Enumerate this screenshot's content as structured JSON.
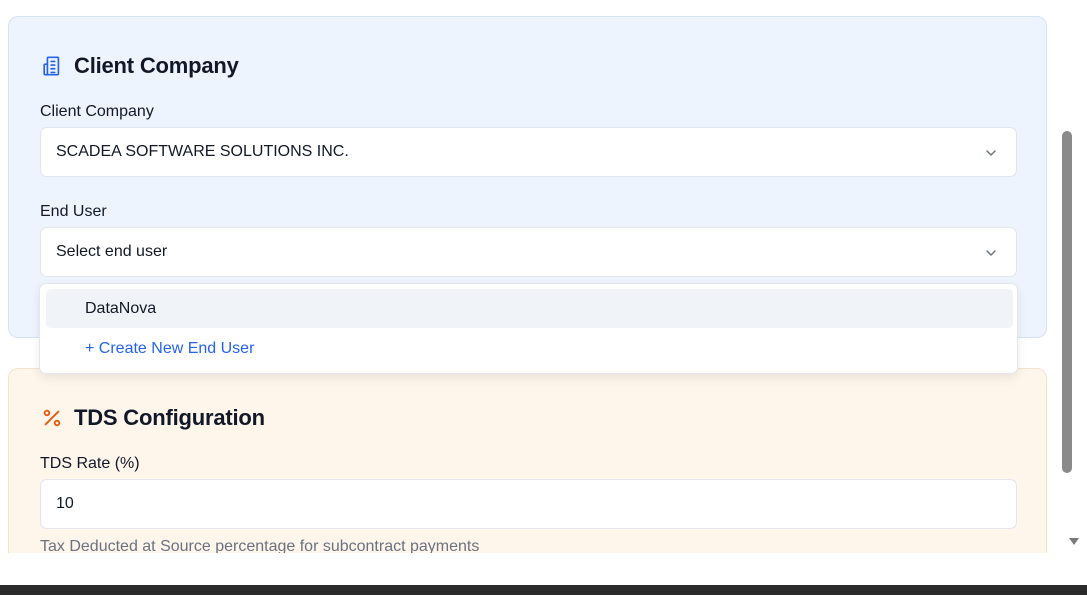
{
  "client_section": {
    "title": "Client Company",
    "icon": "building-icon",
    "accent": "#2563eb",
    "client_label": "Client Company",
    "client_value": "SCADEA SOFTWARE SOLUTIONS INC.",
    "end_user_label": "End User",
    "end_user_placeholder": "Select end user",
    "dropdown_options": [
      "DataNova",
      "+ Create New End User"
    ]
  },
  "tds_section": {
    "title": "TDS Configuration",
    "icon": "percent-icon",
    "accent": "#ea580c",
    "rate_label": "TDS Rate (%)",
    "rate_value": "10",
    "helper_text": "Tax Deducted at Source percentage for subcontract payments"
  }
}
